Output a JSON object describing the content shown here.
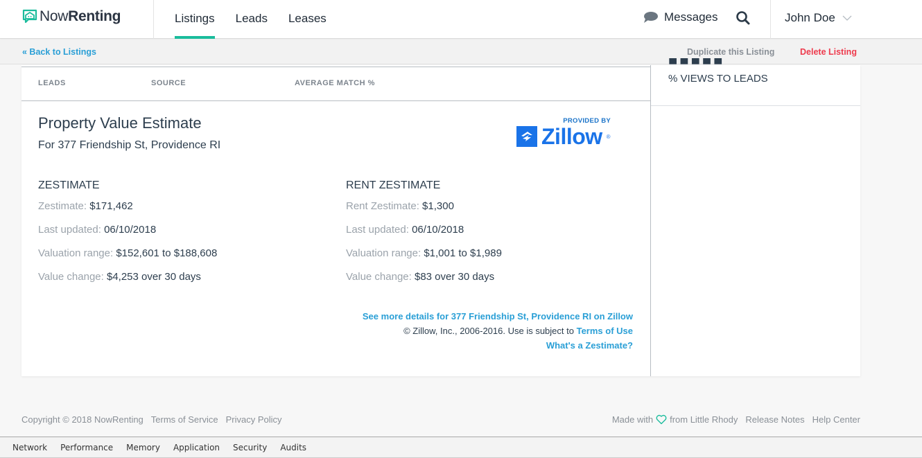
{
  "header": {
    "logo_light": "Now",
    "logo_bold": "Renting",
    "nav": [
      {
        "label": "Listings",
        "active": true
      },
      {
        "label": "Leads",
        "active": false
      },
      {
        "label": "Leases",
        "active": false
      }
    ],
    "messages_label": "Messages",
    "user_name": "John Doe"
  },
  "subbar": {
    "back_label": "« Back to Listings",
    "duplicate_label": "Duplicate this Listing",
    "delete_label": "Delete Listing"
  },
  "leads_table": {
    "headers": [
      "LEADS",
      "SOURCE",
      "AVERAGE MATCH %"
    ]
  },
  "property_estimate": {
    "title": "Property Value Estimate",
    "subtitle": "For 377 Friendship St, Providence RI",
    "provided_by": "PROVIDED BY",
    "brand": "Zillow",
    "zestimate": {
      "heading": "ZESTIMATE",
      "rows": [
        {
          "label": "Zestimate:",
          "value": "$171,462"
        },
        {
          "label": "Last updated:",
          "value": "06/10/2018"
        },
        {
          "label": "Valuation range:",
          "value": "$152,601 to $188,608"
        },
        {
          "label": "Value change:",
          "value": "$4,253 over 30 days"
        }
      ]
    },
    "rent_zestimate": {
      "heading": "RENT ZESTIMATE",
      "rows": [
        {
          "label": "Rent Zestimate:",
          "value": "$1,300"
        },
        {
          "label": "Last updated:",
          "value": "06/10/2018"
        },
        {
          "label": "Valuation range:",
          "value": "$1,001 to $1,989"
        },
        {
          "label": "Value change:",
          "value": "$83 over 30 days"
        }
      ]
    },
    "details_link": "See more details for 377 Friendship St, Providence RI on Zillow",
    "copyright_text": "© Zillow, Inc., 2006-2016. Use is subject to",
    "terms_link": "Terms of Use",
    "whats_link": "What's a Zestimate?"
  },
  "sidebar_stat": {
    "label": "% VIEWS TO LEADS"
  },
  "footer": {
    "copyright": "Copyright © 2018 NowRenting",
    "terms": "Terms of Service",
    "privacy": "Privacy Policy",
    "made_with": "Made with",
    "from": "from Little Rhody",
    "release_notes": "Release Notes",
    "help_center": "Help Center"
  },
  "devtools": {
    "tabs": [
      "Network",
      "Performance",
      "Memory",
      "Application",
      "Security",
      "Audits"
    ]
  },
  "colors": {
    "accent": "#1abc9c",
    "link": "#2a9fd6",
    "danger": "#ee3b4d",
    "zillow": "#1a73e8"
  }
}
